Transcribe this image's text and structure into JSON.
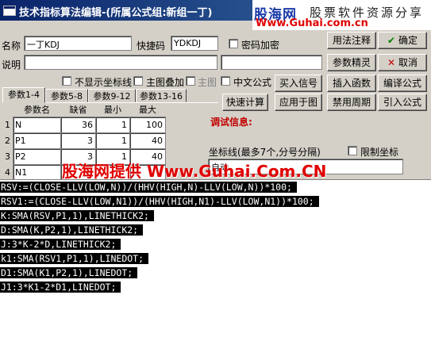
{
  "window": {
    "title": "技术指标算法编辑-(所属公式组:新组一丁)"
  },
  "brand": {
    "logo": "股海网",
    "tagline": "股票软件资源分享",
    "url": "Www.Guhai.com.cn"
  },
  "form": {
    "name_label": "名称",
    "name_value": "一丁KDJ",
    "shortcut_label": "快捷码",
    "shortcut_value": "YDKDJ",
    "password_label": "密码加密",
    "desc_label": "说明",
    "desc_value": ""
  },
  "options": {
    "hide_axis": "不显示坐标线",
    "main_overlay": "主图叠加",
    "main_chart": "主图",
    "chinese_formula": "中文公式"
  },
  "buttons": {
    "use_note": "用法注释",
    "confirm": "确定",
    "param_wizard": "参数精灵",
    "cancel": "取消",
    "import_signal": "买入信号",
    "insert_function": "插入函数",
    "compile_formula": "编译公式",
    "quick_calc": "快速计算",
    "apply_to_chart": "应用于图",
    "disable_period": "禁用周期",
    "import_formula": "引入公式"
  },
  "tabs": [
    "参数1-4",
    "参数5-8",
    "参数9-12",
    "参数13-16"
  ],
  "param_table": {
    "headers": [
      "参数名",
      "缺省",
      "最小",
      "最大"
    ],
    "rows": [
      {
        "num": "1",
        "name": "N",
        "default": "36",
        "min": "1",
        "max": "100"
      },
      {
        "num": "2",
        "name": "P1",
        "default": "3",
        "min": "1",
        "max": "40"
      },
      {
        "num": "3",
        "name": "P2",
        "default": "3",
        "min": "1",
        "max": "40"
      },
      {
        "num": "4",
        "name": "N1",
        "default": "9",
        "min": "",
        "max": ""
      }
    ]
  },
  "debug": {
    "label": "调试信息:"
  },
  "axis": {
    "label": "坐标线(最多7个,分号分隔)",
    "limit_label": "限制坐标",
    "value": "自动"
  },
  "watermark": "股海网提供 Www.Guhai.Com.CN",
  "code_lines": [
    "RSV:=(CLOSE-LLV(LOW,N))/(HHV(HIGH,N)-LLV(LOW,N))*100;",
    "RSV1:=(CLOSE-LLV(LOW,N1))/(HHV(HIGH,N1)-LLV(LOW,N1))*100;",
    "K:SMA(RSV,P1,1),LINETHICK2;",
    "D:SMA(K,P2,1),LINETHICK2;",
    "J:3*K-2*D,LINETHICK2;",
    "k1:SMA(RSV1,P1,1),LINEDOT;",
    "D1:SMA(K1,P2,1),LINEDOT;",
    "J1:3*K1-2*D1,LINEDOT;"
  ],
  "colors": {
    "titlebar": "#0a246a",
    "watermark": "#e00000",
    "debug_label": "#c00000"
  }
}
